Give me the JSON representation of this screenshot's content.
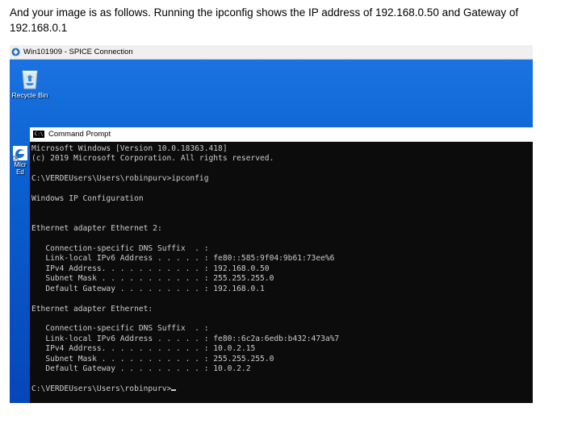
{
  "intro": {
    "text": "And your image is as follows.  Running the ipconfig shows the IP address of 192.168.0.50 and Gateway of 192.168.0.1"
  },
  "spice": {
    "title": "Win101909 - SPICE Connection",
    "icon": "spice-app-icon"
  },
  "desktop": {
    "recycle_bin_label": "Recycle Bin",
    "edge_label": "Micr\nEd"
  },
  "cmd": {
    "title": "Command Prompt",
    "icon_text": "C:\\",
    "lines": [
      "Microsoft Windows [Version 10.0.18363.418]",
      "(c) 2019 Microsoft Corporation. All rights reserved.",
      "",
      "C:\\VERDEUsers\\Users\\robinpurv>ipconfig",
      "",
      "Windows IP Configuration",
      "",
      "",
      "Ethernet adapter Ethernet 2:",
      "",
      "   Connection-specific DNS Suffix  . :",
      "   Link-local IPv6 Address . . . . . : fe80::585:9f04:9b61:73ee%6",
      "   IPv4 Address. . . . . . . . . . . : 192.168.0.50",
      "   Subnet Mask . . . . . . . . . . . : 255.255.255.0",
      "   Default Gateway . . . . . . . . . : 192.168.0.1",
      "",
      "Ethernet adapter Ethernet:",
      "",
      "   Connection-specific DNS Suffix  . :",
      "   Link-local IPv6 Address . . . . . : fe80::6c2a:6edb:b432:473a%7",
      "   IPv4 Address. . . . . . . . . . . : 10.0.2.15",
      "   Subnet Mask . . . . . . . . . . . : 255.255.255.0",
      "   Default Gateway . . . . . . . . . : 10.0.2.2",
      "",
      "C:\\VERDEUsers\\Users\\robinpurv>"
    ]
  }
}
